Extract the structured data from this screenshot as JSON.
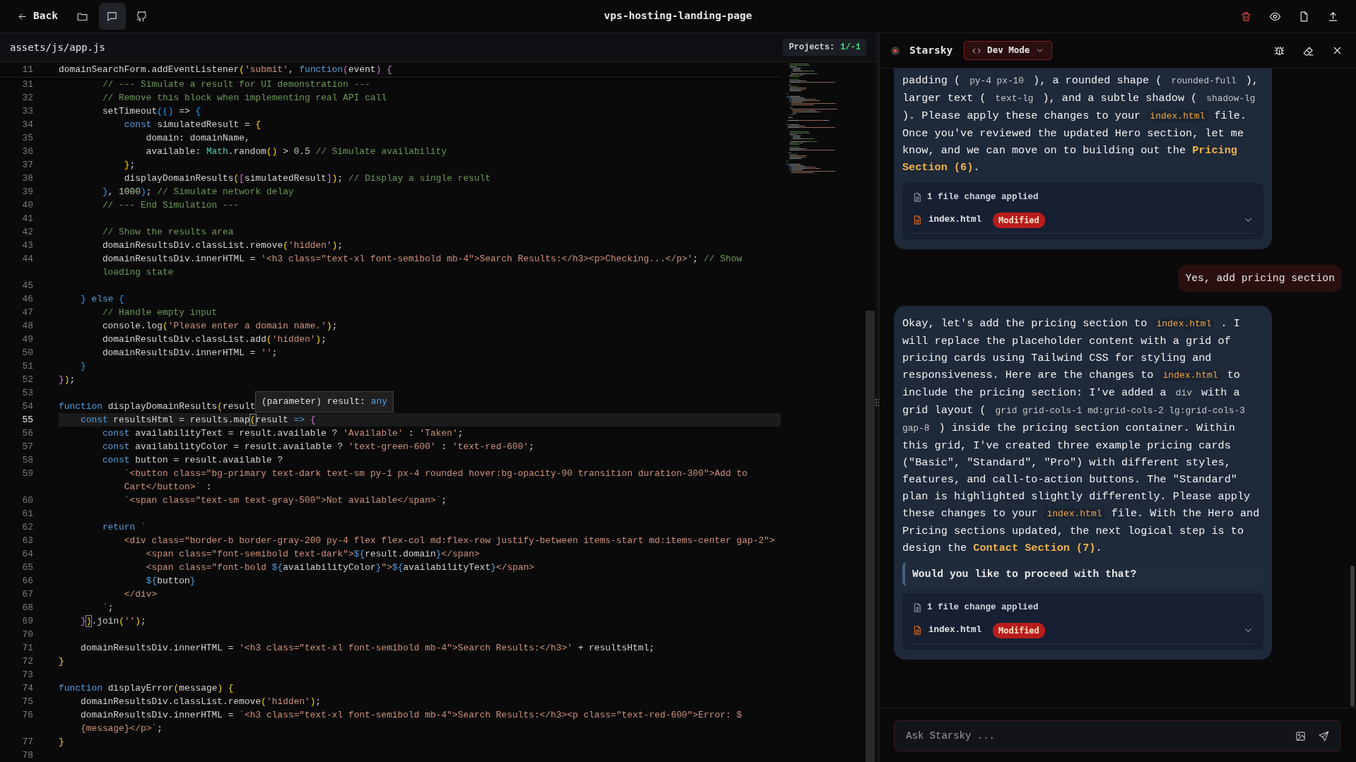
{
  "top_bar": {
    "back": "Back",
    "toolbar": [
      {
        "kind": "folder",
        "selected": false
      },
      {
        "kind": "chat",
        "selected": true
      },
      {
        "kind": "cat",
        "selected": false
      }
    ],
    "title": "vps-hosting-landing-page",
    "actions": [
      {
        "kind": "delete"
      },
      {
        "kind": "preview"
      },
      {
        "kind": "file"
      },
      {
        "kind": "export"
      }
    ]
  },
  "editor": {
    "file_path": "assets/js/app.js",
    "projects_label": "Projects:",
    "projects_value": "1/-1",
    "sticky_line": {
      "number": "11",
      "segments": [
        {
          "kind": "plain",
          "text": "domainSearchForm.addEventListener"
        },
        {
          "kind": "bracket1",
          "text": "("
        },
        {
          "kind": "string",
          "text": "'submit'"
        },
        {
          "kind": "plain",
          "text": ", "
        },
        {
          "kind": "keyword",
          "text": "function"
        },
        {
          "kind": "bracket2",
          "text": "("
        },
        {
          "kind": "plain",
          "text": "event"
        },
        {
          "kind": "bracket2",
          "text": ")"
        },
        {
          "kind": "bracket2",
          "text": " {"
        }
      ]
    },
    "lines": [
      {
        "number": "31",
        "current": false,
        "segments": [
          {
            "kind": "comment",
            "text": "        // --- Simulate a result for UI demonstration ---"
          }
        ]
      },
      {
        "number": "32",
        "current": false,
        "segments": [
          {
            "kind": "comment",
            "text": "        // Remove this block when implementing real API call"
          }
        ]
      },
      {
        "number": "33",
        "current": false,
        "segments": [
          {
            "kind": "plain",
            "text": "        setTimeout"
          },
          {
            "kind": "bracket3",
            "text": "(()"
          },
          {
            "kind": "plain",
            "text": " => "
          },
          {
            "kind": "bracket3",
            "text": "{"
          }
        ]
      },
      {
        "number": "34",
        "current": false,
        "segments": [
          {
            "kind": "keyword",
            "text": "            const"
          },
          {
            "kind": "plain",
            "text": " simulatedResult = "
          },
          {
            "kind": "bracket1",
            "text": "{"
          }
        ]
      },
      {
        "number": "35",
        "current": false,
        "segments": [
          {
            "kind": "plain",
            "text": "                domain: domainName,"
          }
        ]
      },
      {
        "number": "36",
        "current": false,
        "segments": [
          {
            "kind": "plain",
            "text": "                available: "
          },
          {
            "kind": "type",
            "text": "Math"
          },
          {
            "kind": "plain",
            "text": ".random"
          },
          {
            "kind": "bracket1",
            "text": "()"
          },
          {
            "kind": "plain",
            "text": " > "
          },
          {
            "kind": "number",
            "text": "0.5"
          },
          {
            "kind": "comment",
            "text": " // Simulate availability"
          }
        ]
      },
      {
        "number": "37",
        "current": false,
        "segments": [
          {
            "kind": "bracket1",
            "text": "            }"
          },
          {
            "kind": "plain",
            "text": ";"
          }
        ]
      },
      {
        "number": "38",
        "current": false,
        "segments": [
          {
            "kind": "plain",
            "text": "            displayDomainResults"
          },
          {
            "kind": "bracket1",
            "text": "("
          },
          {
            "kind": "bracket2",
            "text": "["
          },
          {
            "kind": "plain",
            "text": "simulatedResult"
          },
          {
            "kind": "bracket2",
            "text": "]"
          },
          {
            "kind": "bracket1",
            "text": ")"
          },
          {
            "kind": "plain",
            "text": "; "
          },
          {
            "kind": "comment",
            "text": "// Display a single result"
          }
        ]
      },
      {
        "number": "39",
        "current": false,
        "segments": [
          {
            "kind": "bracket3",
            "text": "        }"
          },
          {
            "kind": "plain",
            "text": ", "
          },
          {
            "kind": "number",
            "text": "1000"
          },
          {
            "kind": "bracket3",
            "text": ")"
          },
          {
            "kind": "plain",
            "text": "; "
          },
          {
            "kind": "comment",
            "text": "// Simulate network delay"
          }
        ]
      },
      {
        "number": "40",
        "current": false,
        "segments": [
          {
            "kind": "comment",
            "text": "        // --- End Simulation ---"
          }
        ]
      },
      {
        "number": "41",
        "current": false
      },
      {
        "number": "42",
        "current": false,
        "segments": [
          {
            "kind": "comment",
            "text": "        // Show the results area"
          }
        ]
      },
      {
        "number": "43",
        "current": false,
        "segments": [
          {
            "kind": "plain",
            "text": "        domainResultsDiv.classList.remove"
          },
          {
            "kind": "bracket1",
            "text": "("
          },
          {
            "kind": "string",
            "text": "'hidden'"
          },
          {
            "kind": "bracket1",
            "text": ")"
          },
          {
            "kind": "plain",
            "text": ";"
          }
        ]
      },
      {
        "number": "44",
        "current": false,
        "segments": [
          {
            "kind": "plain",
            "text": "        domainResultsDiv.innerHTML = "
          },
          {
            "kind": "string",
            "text": "'<h3 class=\"text-xl font-semibold mb-4\">Search Results:</h3><p>Checking...</p>'"
          },
          {
            "kind": "plain",
            "text": "; "
          },
          {
            "kind": "comment",
            "text": "// Show"
          }
        ],
        "continuation": [
          {
            "kind": "comment",
            "text": "loading state"
          }
        ]
      },
      {
        "number": "45",
        "current": false
      },
      {
        "number": "46",
        "current": false,
        "segments": [
          {
            "kind": "bracket3",
            "text": "    }"
          },
          {
            "kind": "keyword",
            "text": " else"
          },
          {
            "kind": "bracket3",
            "text": " {"
          }
        ]
      },
      {
        "number": "47",
        "current": false,
        "segments": [
          {
            "kind": "comment",
            "text": "        // Handle empty input"
          }
        ]
      },
      {
        "number": "48",
        "current": false,
        "segments": [
          {
            "kind": "plain",
            "text": "        console.log"
          },
          {
            "kind": "bracket1",
            "text": "("
          },
          {
            "kind": "string",
            "text": "'Please enter a domain name.'"
          },
          {
            "kind": "bracket1",
            "text": ")"
          },
          {
            "kind": "plain",
            "text": ";"
          }
        ]
      },
      {
        "number": "49",
        "current": false,
        "segments": [
          {
            "kind": "plain",
            "text": "        domainResultsDiv.classList.add"
          },
          {
            "kind": "bracket1",
            "text": "("
          },
          {
            "kind": "string",
            "text": "'hidden'"
          },
          {
            "kind": "bracket1",
            "text": ")"
          },
          {
            "kind": "plain",
            "text": ";"
          }
        ]
      },
      {
        "number": "50",
        "current": false,
        "segments": [
          {
            "kind": "plain",
            "text": "        domainResultsDiv.innerHTML = "
          },
          {
            "kind": "string",
            "text": "''"
          },
          {
            "kind": "plain",
            "text": ";"
          }
        ]
      },
      {
        "number": "51",
        "current": false,
        "segments": [
          {
            "kind": "bracket3",
            "text": "    }"
          }
        ]
      },
      {
        "number": "52",
        "current": false,
        "segments": [
          {
            "kind": "bracket2",
            "text": "}"
          },
          {
            "kind": "bracket1",
            "text": ")"
          },
          {
            "kind": "plain",
            "text": ";"
          }
        ]
      },
      {
        "number": "53",
        "current": false
      },
      {
        "number": "54",
        "current": false,
        "segments": [
          {
            "kind": "keyword",
            "text": "function"
          },
          {
            "kind": "plain",
            "text": " displayDomainResults"
          },
          {
            "kind": "bracket1",
            "text": "("
          },
          {
            "kind": "plain",
            "text": "result"
          }
        ],
        "tooltip": {
          "label": "(parameter) result:",
          "type": "any"
        }
      },
      {
        "number": "55",
        "current": true,
        "segments": [
          {
            "kind": "keyword",
            "text": "    const"
          },
          {
            "kind": "plain",
            "text": " resultsHtml = results.map"
          },
          {
            "kind": "match",
            "text": "("
          },
          {
            "kind": "plain",
            "text": "result "
          },
          {
            "kind": "keyword",
            "text": "=>"
          },
          {
            "kind": "bracket2",
            "text": " {"
          }
        ]
      },
      {
        "number": "56",
        "current": false,
        "segments": [
          {
            "kind": "keyword",
            "text": "        const"
          },
          {
            "kind": "plain",
            "text": " availabilityText = result.available ? "
          },
          {
            "kind": "string",
            "text": "'Available'"
          },
          {
            "kind": "plain",
            "text": " : "
          },
          {
            "kind": "string",
            "text": "'Taken'"
          },
          {
            "kind": "plain",
            "text": ";"
          }
        ]
      },
      {
        "number": "57",
        "current": false,
        "segments": [
          {
            "kind": "keyword",
            "text": "        const"
          },
          {
            "kind": "plain",
            "text": " availabilityColor = result.available ? "
          },
          {
            "kind": "string",
            "text": "'text-green-600'"
          },
          {
            "kind": "plain",
            "text": " : "
          },
          {
            "kind": "string",
            "text": "'text-red-600'"
          },
          {
            "kind": "plain",
            "text": ";"
          }
        ]
      },
      {
        "number": "58",
        "current": false,
        "segments": [
          {
            "kind": "keyword",
            "text": "        const"
          },
          {
            "kind": "plain",
            "text": " button = result.available ?"
          }
        ]
      },
      {
        "number": "59",
        "current": false,
        "segments": [
          {
            "kind": "string",
            "text": "            `<button class=\"bg-primary text-dark text-sm py-1 px-4 rounded hover:bg-opacity-90 transition duration-300\">Add to"
          }
        ],
        "continuation": [
          {
            "kind": "string",
            "text": "Cart</button>`"
          },
          {
            "kind": "plain",
            "text": " :"
          }
        ]
      },
      {
        "number": "60",
        "current": false,
        "segments": [
          {
            "kind": "string",
            "text": "            `<span class=\"text-sm text-gray-500\">Not available</span>`"
          },
          {
            "kind": "plain",
            "text": ";"
          }
        ]
      },
      {
        "number": "61",
        "current": false
      },
      {
        "number": "62",
        "current": false,
        "segments": [
          {
            "kind": "keyword",
            "text": "        return"
          },
          {
            "kind": "string",
            "text": " `"
          }
        ]
      },
      {
        "number": "63",
        "current": false,
        "segments": [
          {
            "kind": "string",
            "text": "            <div class=\"border-b border-gray-200 py-4 flex flex-col md:flex-row justify-between items-start md:items-center gap-2\">"
          }
        ]
      },
      {
        "number": "64",
        "current": false,
        "segments": [
          {
            "kind": "string",
            "text": "                <span class=\"font-semibold text-dark\">"
          },
          {
            "kind": "keyword",
            "text": "${"
          },
          {
            "kind": "plain",
            "text": "result.domain"
          },
          {
            "kind": "keyword",
            "text": "}"
          },
          {
            "kind": "string",
            "text": "</span>"
          }
        ]
      },
      {
        "number": "65",
        "current": false,
        "segments": [
          {
            "kind": "string",
            "text": "                <span class=\"font-bold "
          },
          {
            "kind": "keyword",
            "text": "${"
          },
          {
            "kind": "plain",
            "text": "availabilityColor"
          },
          {
            "kind": "keyword",
            "text": "}"
          },
          {
            "kind": "string",
            "text": "\">"
          },
          {
            "kind": "keyword",
            "text": "${"
          },
          {
            "kind": "plain",
            "text": "availabilityText"
          },
          {
            "kind": "keyword",
            "text": "}"
          },
          {
            "kind": "string",
            "text": "</span>"
          }
        ]
      },
      {
        "number": "66",
        "current": false,
        "segments": [
          {
            "kind": "keyword",
            "text": "                ${"
          },
          {
            "kind": "plain",
            "text": "button"
          },
          {
            "kind": "keyword",
            "text": "}"
          }
        ]
      },
      {
        "number": "67",
        "current": false,
        "segments": [
          {
            "kind": "string",
            "text": "            </div>"
          }
        ]
      },
      {
        "number": "68",
        "current": false,
        "segments": [
          {
            "kind": "string",
            "text": "        `"
          },
          {
            "kind": "plain",
            "text": ";"
          }
        ]
      },
      {
        "number": "69",
        "current": false,
        "segments": [
          {
            "kind": "bracket2",
            "text": "    }"
          },
          {
            "kind": "match",
            "text": ")"
          },
          {
            "kind": "plain",
            "text": ".join"
          },
          {
            "kind": "bracket1",
            "text": "("
          },
          {
            "kind": "string",
            "text": "''"
          },
          {
            "kind": "bracket1",
            "text": ")"
          },
          {
            "kind": "plain",
            "text": ";"
          }
        ]
      },
      {
        "number": "70",
        "current": false
      },
      {
        "number": "71",
        "current": false,
        "segments": [
          {
            "kind": "plain",
            "text": "    domainResultsDiv.innerHTML = "
          },
          {
            "kind": "string",
            "text": "'<h3 class=\"text-xl font-semibold mb-4\">Search Results:</h3>'"
          },
          {
            "kind": "plain",
            "text": " + resultsHtml;"
          }
        ]
      },
      {
        "number": "72",
        "current": false,
        "segments": [
          {
            "kind": "bracket1",
            "text": "}"
          }
        ]
      },
      {
        "number": "73",
        "current": false
      },
      {
        "number": "74",
        "current": false,
        "segments": [
          {
            "kind": "keyword",
            "text": "function"
          },
          {
            "kind": "plain",
            "text": " displayError"
          },
          {
            "kind": "bracket1",
            "text": "("
          },
          {
            "kind": "plain",
            "text": "message"
          },
          {
            "kind": "bracket1",
            "text": ")"
          },
          {
            "kind": "bracket1",
            "text": " {"
          }
        ]
      },
      {
        "number": "75",
        "current": false,
        "segments": [
          {
            "kind": "plain",
            "text": "    domainResultsDiv.classList.remove"
          },
          {
            "kind": "bracket1",
            "text": "("
          },
          {
            "kind": "string",
            "text": "'hidden'"
          },
          {
            "kind": "bracket1",
            "text": ")"
          },
          {
            "kind": "plain",
            "text": ";"
          }
        ]
      },
      {
        "number": "76",
        "current": false,
        "segments": [
          {
            "kind": "plain",
            "text": "    domainResultsDiv.innerHTML = "
          },
          {
            "kind": "string",
            "text": "`<h3 class=\"text-xl font-semibold mb-4\">Search Results:</h3><p class=\"text-red-600\">Error: $"
          }
        ],
        "continuation": [
          {
            "kind": "string",
            "text": "{message}</p>`"
          },
          {
            "kind": "plain",
            "text": ";"
          }
        ]
      },
      {
        "number": "77",
        "current": false,
        "segments": [
          {
            "kind": "bracket1",
            "text": "}"
          }
        ]
      },
      {
        "number": "78",
        "current": false
      }
    ]
  },
  "chat": {
    "title": "Starsky",
    "mode": "Dev Mode",
    "messages": [
      {
        "kind": "assistant",
        "paragraph": [
          {
            "kind": "text",
            "text": "padding ( "
          },
          {
            "kind": "code",
            "text": "py-4 px-10"
          },
          {
            "kind": "text",
            "text": " ), a rounded shape ( "
          },
          {
            "kind": "code",
            "text": "rounded-full"
          },
          {
            "kind": "text",
            "text": " ), larger text ( "
          },
          {
            "kind": "code",
            "text": "text-lg"
          },
          {
            "kind": "text",
            "text": " ), and a subtle shadow ( "
          },
          {
            "kind": "code",
            "text": "shadow-lg"
          },
          {
            "kind": "text",
            "text": " ). Please apply these changes to your "
          },
          {
            "kind": "file",
            "text": "index.html"
          },
          {
            "kind": "text",
            "text": " file. Once you've reviewed the updated Hero section, let me know, and we can move on to building out the "
          },
          {
            "kind": "strong",
            "text": "Pricing Section (6)"
          },
          {
            "kind": "text",
            "text": "."
          }
        ],
        "file_changes": {
          "summary": "1 file change applied",
          "files": [
            {
              "name": "index.html",
              "status": "Modified"
            }
          ]
        }
      },
      {
        "kind": "user",
        "text": "Yes, add pricing section"
      },
      {
        "kind": "assistant",
        "paragraph": [
          {
            "kind": "text",
            "text": "Okay, let's add the pricing section to "
          },
          {
            "kind": "file",
            "text": "index.html"
          },
          {
            "kind": "text",
            "text": " . I will replace the placeholder content with a grid of pricing cards using Tailwind CSS for styling and responsiveness. Here are the changes to "
          },
          {
            "kind": "file",
            "text": "index.html"
          },
          {
            "kind": "text",
            "text": " to include the pricing section: I've added a "
          },
          {
            "kind": "code",
            "text": "div"
          },
          {
            "kind": "text",
            "text": " with a grid layout ( "
          },
          {
            "kind": "code",
            "text": "grid grid-cols-1 md:grid-cols-2 lg:grid-cols-3 gap-8"
          },
          {
            "kind": "text",
            "text": " ) inside the pricing section container. Within this grid, I've created three example pricing cards (\"Basic\", \"Standard\", \"Pro\") with different styles, features, and call-to-action buttons. The \"Standard\" plan is highlighted slightly differently. Please apply these changes to your "
          },
          {
            "kind": "file",
            "text": "index.html"
          },
          {
            "kind": "text",
            "text": " file. With the Hero and Pricing sections updated, the next logical step is to design the "
          },
          {
            "kind": "strong",
            "text": "Contact Section (7)"
          },
          {
            "kind": "text",
            "text": "."
          }
        ],
        "quote": "Would you like to proceed with that?",
        "file_changes": {
          "summary": "1 file change applied",
          "files": [
            {
              "name": "index.html",
              "status": "Modified"
            }
          ]
        }
      }
    ],
    "input": {
      "placeholder": "Ask Starsky ..."
    }
  }
}
